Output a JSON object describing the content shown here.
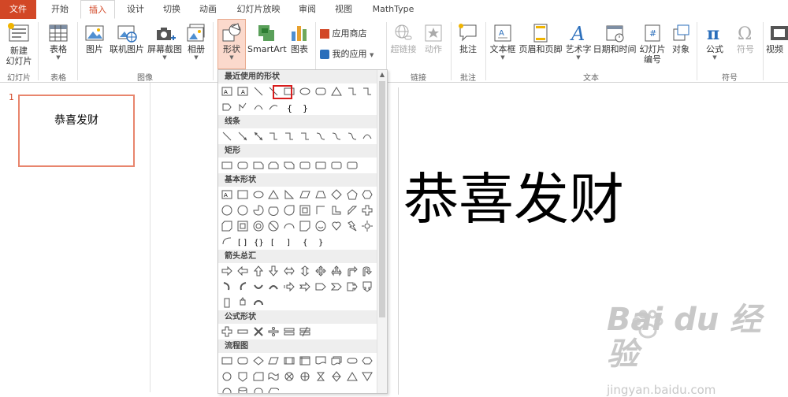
{
  "tabs": [
    {
      "label": "文件"
    },
    {
      "label": "开始"
    },
    {
      "label": "插入"
    },
    {
      "label": "设计"
    },
    {
      "label": "切换"
    },
    {
      "label": "动画"
    },
    {
      "label": "幻灯片放映"
    },
    {
      "label": "审阅"
    },
    {
      "label": "视图"
    },
    {
      "label": "MathType"
    }
  ],
  "ribbon": {
    "new_slide_line1": "新建",
    "new_slide_line2": "幻灯片",
    "table": "表格",
    "picture": "图片",
    "online_picture": "联机图片",
    "screenshot": "屏幕截图",
    "album": "相册",
    "shapes": "形状",
    "smartart": "SmartArt",
    "chart": "图表",
    "app_store": "应用商店",
    "my_apps": "我的应用",
    "hyperlink": "超链接",
    "action": "动作",
    "comment": "批注",
    "textbox": "文本框",
    "header_footer": "页眉和页脚",
    "wordart": "艺术字",
    "datetime": "日期和时间",
    "slide_number_line1": "幻灯片",
    "slide_number_line2": "编号",
    "object": "对象",
    "equation": "公式",
    "symbol": "符号",
    "video": "视频",
    "groups": {
      "slides": "幻灯片",
      "tables": "表格",
      "images": "图像",
      "links": "链接",
      "comments": "批注",
      "text": "文本",
      "symbols": "符号"
    }
  },
  "slide_thumbnail": {
    "number": "1",
    "text": "恭喜发财"
  },
  "slide": {
    "text": "恭喜发财"
  },
  "watermark": {
    "main": "Bai du 经验",
    "sub": "jingyan.baidu.com"
  },
  "shapes_panel": {
    "recent": "最近使用的形状",
    "lines": "线条",
    "rectangles": "矩形",
    "basic": "基本形状",
    "arrows": "箭头总汇",
    "equation": "公式形状",
    "flowchart": "流程图"
  },
  "colors": {
    "file_tab": "#d24726",
    "accent": "#d24726",
    "highlight": "#d81c1c",
    "thumb_border": "#e8856d"
  }
}
